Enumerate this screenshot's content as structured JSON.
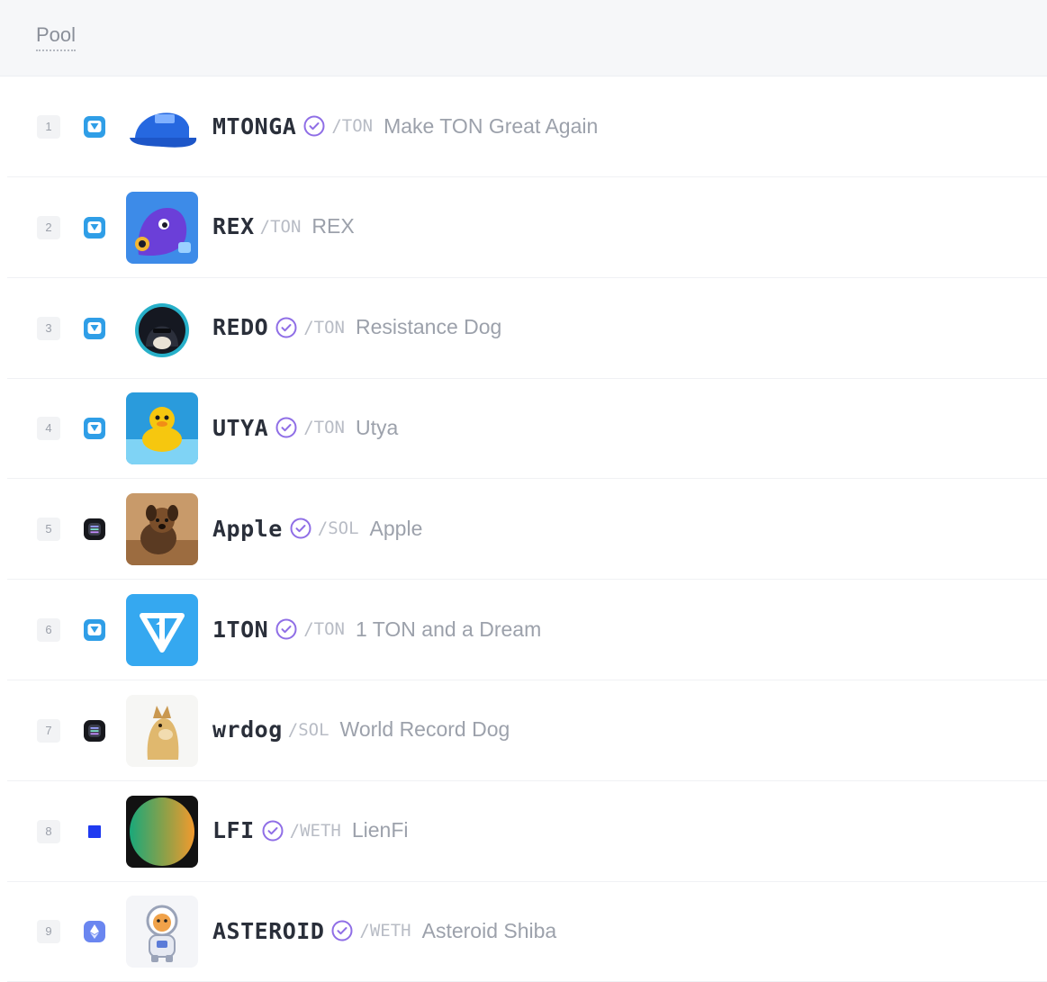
{
  "header": {
    "title": "Pool"
  },
  "colors": {
    "verified": "#8f6ee6",
    "ton": "#2f9ee7",
    "sol": "#17181d",
    "weth_blue": "#1f3af0",
    "eth": "#6a86f0"
  },
  "rows": [
    {
      "rank": "1",
      "chain_icon": "ton-icon",
      "avatar": "blue-cap",
      "symbol": "MTONGA",
      "verified": true,
      "pair": "/TON",
      "name": "Make TON Great Again"
    },
    {
      "rank": "2",
      "chain_icon": "ton-icon",
      "avatar": "purple-rex",
      "symbol": "REX",
      "verified": false,
      "pair": "/TON",
      "name": "REX"
    },
    {
      "rank": "3",
      "chain_icon": "ton-icon",
      "avatar": "hooded-dog",
      "symbol": "REDO",
      "verified": true,
      "pair": "/TON",
      "name": "Resistance Dog"
    },
    {
      "rank": "4",
      "chain_icon": "ton-icon",
      "avatar": "yellow-duck",
      "symbol": "UTYA",
      "verified": true,
      "pair": "/TON",
      "name": "Utya"
    },
    {
      "rank": "5",
      "chain_icon": "sol-icon",
      "avatar": "puppy-photo",
      "symbol": "Apple",
      "verified": true,
      "pair": "/SOL",
      "name": "Apple"
    },
    {
      "rank": "6",
      "chain_icon": "ton-icon",
      "avatar": "ton-logo",
      "symbol": "1TON",
      "verified": true,
      "pair": "/TON",
      "name": "1 TON and a Dream"
    },
    {
      "rank": "7",
      "chain_icon": "sol-icon",
      "avatar": "doge-dog",
      "symbol": "wrdog",
      "verified": false,
      "pair": "/SOL",
      "name": "World Record Dog"
    },
    {
      "rank": "8",
      "chain_icon": "square-icon",
      "avatar": "gradient-circle",
      "symbol": "LFI",
      "verified": true,
      "pair": "/WETH",
      "name": "LienFi"
    },
    {
      "rank": "9",
      "chain_icon": "eth-icon",
      "avatar": "shiba-astronaut",
      "symbol": "ASTEROID",
      "verified": true,
      "pair": "/WETH",
      "name": "Asteroid Shiba"
    }
  ]
}
